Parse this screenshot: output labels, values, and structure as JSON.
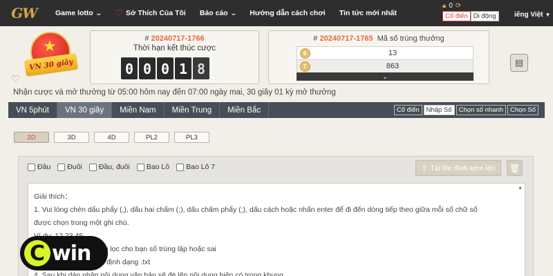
{
  "brand": {
    "logo_text": "GW"
  },
  "nav": {
    "items": [
      {
        "label": "Game lotto",
        "dropdown": true
      },
      {
        "label": "Sở Thích Của Tôi",
        "icon": "heart-icon"
      },
      {
        "label": "Báo cáo",
        "dropdown": true
      },
      {
        "label": "Hướng dẫn cách chơi"
      },
      {
        "label": "Tin tức mới nhất"
      }
    ],
    "balance": "0",
    "view_toggle": [
      "Cổ điển",
      "Di động"
    ],
    "view_active": "Cổ điển",
    "language": "iếng Việt"
  },
  "badge": {
    "label": "VN 30 giây"
  },
  "countdown": {
    "hash": "#",
    "draw_id": "20240717-1766",
    "subtitle": "Thời hạn kết thúc cược",
    "digits": [
      "0",
      "0",
      "0",
      "1",
      "8"
    ]
  },
  "results": {
    "hash": "#",
    "draw_id": "20240717-1765",
    "label": "Mã số trúng thưởng",
    "rows": [
      {
        "ball": "8",
        "value": "13"
      },
      {
        "ball": "7",
        "value": "863"
      }
    ]
  },
  "notice": "Nhận cược và mở thưởng từ 05:00 hôm nay đến 07:00 ngày mai,   30 giây 01 kỳ mở thưởng",
  "tabs": [
    "VN 5phút",
    "VN 30 giây",
    "Miền Nam",
    "Miền Trung",
    "Miền Bắc"
  ],
  "active_tab": "VN 30 giây",
  "modes": [
    "Cổ điển",
    "Nhập Số",
    "Chọn số nhanh",
    "Chọn Số"
  ],
  "active_mode": "Nhập Số",
  "game_types": [
    "2D",
    "3D",
    "4D",
    "PL2",
    "PL3"
  ],
  "active_game_type": "2D",
  "checkboxes": [
    "Đầu",
    "Đuôi",
    "Đầu, đuôi",
    "Bao Lô",
    "Bao Lô 7"
  ],
  "upload_label": "Tải file đính kèm lên",
  "instructions": [
    "Giải thích：",
    "1. Vui lòng chèn dấu phẩy (,), dấu hai chấm (:), dấu chấm phẩy (;), dấu cách hoặc nhấn enter để đi đến dòng tiếp theo giữa mỗi số chữ số",
    "được chọn trong một ghi chú.",
    "Ví dụ: 12 23 45",
    "2. Hệ thống sẽ tự động lọc cho bạn số trùng lặp hoặc sai",
    "3. Định dạng tệp tin là định dạng .txt",
    "4. Sau khi dán nhập nội dung văn bản sẽ đè lên nội dung hiện có trong khung"
  ],
  "watermark": {
    "c": "C",
    "rest": "win"
  },
  "colors": {
    "nav_bg": "#2e2e2e",
    "accent_orange": "#e8663a",
    "accent_red": "#d1433a",
    "tab_bg": "#474e55",
    "watermark_lime": "#d8f52a"
  }
}
